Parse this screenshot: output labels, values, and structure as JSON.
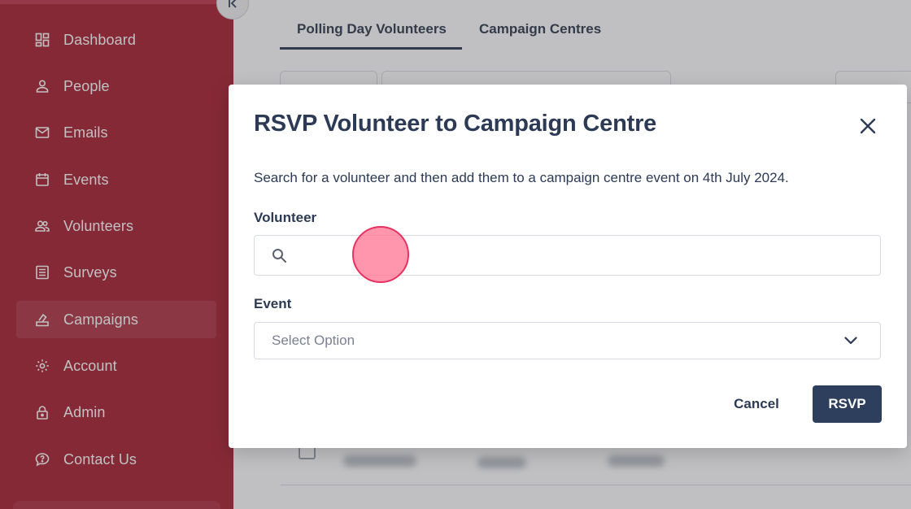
{
  "sidebar": {
    "items": [
      {
        "label": "Dashboard",
        "icon": "dashboard-icon"
      },
      {
        "label": "People",
        "icon": "person-icon"
      },
      {
        "label": "Emails",
        "icon": "mail-icon"
      },
      {
        "label": "Events",
        "icon": "calendar-icon"
      },
      {
        "label": "Volunteers",
        "icon": "group-icon"
      },
      {
        "label": "Surveys",
        "icon": "survey-icon"
      },
      {
        "label": "Campaigns",
        "icon": "ballot-icon",
        "active": true
      },
      {
        "label": "Account",
        "icon": "gear-icon"
      },
      {
        "label": "Admin",
        "icon": "lock-icon"
      },
      {
        "label": "Contact Us",
        "icon": "chat-icon"
      }
    ]
  },
  "main": {
    "tabs": [
      {
        "label": "Polling Day Volunteers",
        "active": true
      },
      {
        "label": "Campaign Centres",
        "active": false
      }
    ]
  },
  "modal": {
    "title": "RSVP Volunteer to Campaign Centre",
    "description": "Search for a volunteer and then add them to a campaign centre event on 4th July 2024.",
    "volunteer_label": "Volunteer",
    "volunteer_value": "",
    "event_label": "Event",
    "event_placeholder": "Select Option",
    "cancel_label": "Cancel",
    "rsvp_label": "RSVP"
  },
  "colors": {
    "sidebar_bg": "#a81a2c",
    "primary_button": "#2e3f5e",
    "heading_text": "#2c3a55",
    "click_indicator": "#ff7896"
  }
}
